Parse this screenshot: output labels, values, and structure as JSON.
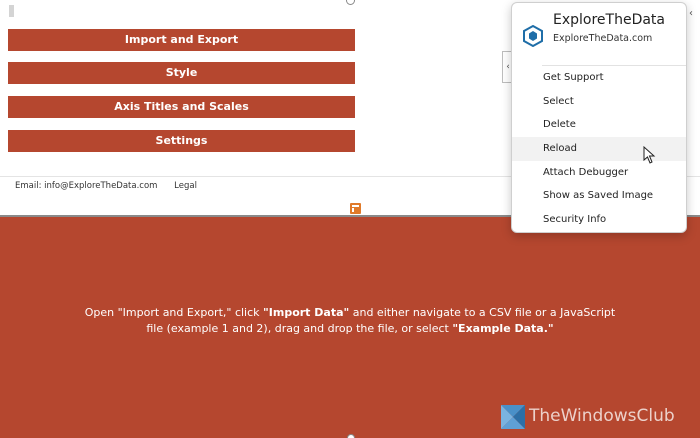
{
  "menu_buttons": [
    {
      "label": "Import and Export"
    },
    {
      "label": "Style"
    },
    {
      "label": "Axis Titles and Scales"
    },
    {
      "label": "Settings"
    }
  ],
  "footer": {
    "email": "Email:  info@ExploreTheData.com",
    "legal": "Legal"
  },
  "panel": {
    "text_1": "Open \"Import and Export,\" click ",
    "bold_1": "\"Import Data\"",
    "text_2": " and either navigate to a CSV file or a JavaScript file (example 1 and 2), drag and drop the file, or select ",
    "bold_2": "\"Example Data.\""
  },
  "dropdown": {
    "title": "ExploreTheData",
    "subtitle": "ExploreTheData.com",
    "items": [
      {
        "label": "Get Support"
      },
      {
        "label": "Select"
      },
      {
        "label": "Delete"
      },
      {
        "label": "Reload"
      },
      {
        "label": "Attach Debugger"
      },
      {
        "label": "Show as Saved Image"
      },
      {
        "label": "Security Info"
      }
    ],
    "hovered_item": "Reload"
  },
  "icons": {
    "side_tab": "chevron-left-icon",
    "top_right": "chevron-left-icon",
    "addin": "addin-hexagon-icon",
    "layout": "layout-icon",
    "cursor": "mouse-pointer-icon"
  },
  "watermark": {
    "text": "TheWindowsClub"
  },
  "colors": {
    "accent": "#b5472f",
    "icon_blue": "#1f6ea8",
    "layout_orange": "#e07a2a"
  }
}
